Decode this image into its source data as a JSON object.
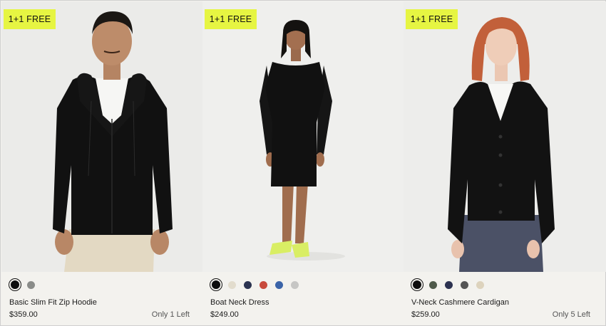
{
  "products": [
    {
      "badge": "1+1 FREE",
      "image_alt": "man wearing black zip hoodie",
      "swatches": [
        "#0d0d0d",
        "#8a8c89"
      ],
      "selected_swatch": 0,
      "name": "Basic Slim Fit Zip Hoodie",
      "price": "$359.00",
      "stock": "Only 1 Left"
    },
    {
      "badge": "1+1 FREE",
      "image_alt": "woman wearing black boat neck dress",
      "swatches": [
        "#0d0d0d",
        "#e2dccd",
        "#2b3350",
        "#c84a3c",
        "#3b64a8",
        "#c6c6c4"
      ],
      "selected_swatch": 0,
      "name": "Boat Neck Dress",
      "price": "$249.00",
      "stock": ""
    },
    {
      "badge": "1+1 FREE",
      "image_alt": "woman wearing black v-neck cashmere cardigan",
      "swatches": [
        "#0d0d0d",
        "#4f5a4a",
        "#2c3250",
        "#555555",
        "#ddd3bd"
      ],
      "selected_swatch": 0,
      "name": "V-Neck Cashmere Cardigan",
      "price": "$259.00",
      "stock": "Only 5 Left"
    }
  ],
  "colors": {
    "badge_bg": "#e6f542",
    "page_bg": "#f3f2ee"
  }
}
